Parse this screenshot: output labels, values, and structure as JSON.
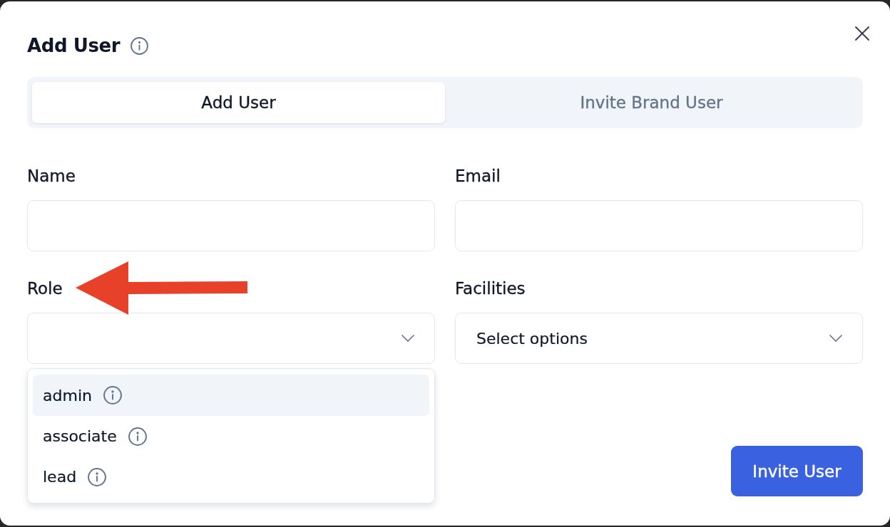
{
  "dialog": {
    "title": "Add User"
  },
  "tabs": [
    {
      "label": "Add User",
      "selected": true
    },
    {
      "label": "Invite Brand User",
      "selected": false
    }
  ],
  "fields": [
    {
      "kind": "text",
      "label": "Name"
    },
    {
      "kind": "text",
      "label": "Email"
    },
    {
      "kind": "select",
      "label": "Role",
      "expanded": true,
      "options": [
        {
          "label": "admin",
          "selected": true
        },
        {
          "label": "associate",
          "selected": false
        },
        {
          "label": "lead",
          "selected": false
        }
      ]
    },
    {
      "kind": "select",
      "label": "Facilities",
      "placeholder": "Select options"
    }
  ],
  "submit_button": {
    "label": "Invite User"
  }
}
